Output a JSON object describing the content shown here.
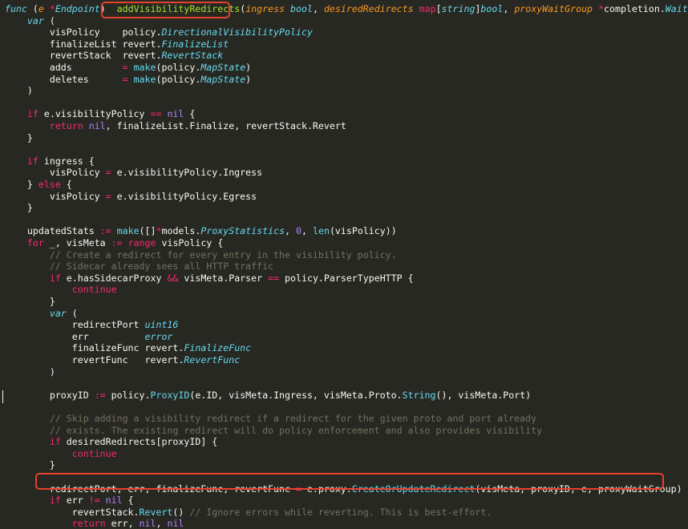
{
  "colors": {
    "background": "#272822",
    "plain": "#f8f8f2",
    "keyword": "#f92672",
    "type": "#66d9ef",
    "function": "#a6e22e",
    "parameter": "#fd971f",
    "number": "#ae81ff",
    "comment": "#75715e",
    "highlight_box": "#e8412e"
  },
  "code_lines": [
    [
      [
        "kwi",
        "func"
      ],
      [
        "plain",
        " ("
      ],
      [
        "param",
        "e"
      ],
      [
        "plain",
        " "
      ],
      [
        "op",
        "*"
      ],
      [
        "type",
        "Endpoint"
      ],
      [
        "plain",
        ")  "
      ],
      [
        "fn",
        "addVisibilityRedirects"
      ],
      [
        "plain",
        "("
      ],
      [
        "param",
        "ingress"
      ],
      [
        "plain",
        " "
      ],
      [
        "type",
        "bool"
      ],
      [
        "plain",
        ", "
      ],
      [
        "param",
        "desiredRedirects"
      ],
      [
        "plain",
        " "
      ],
      [
        "kw",
        "map"
      ],
      [
        "plain",
        "["
      ],
      [
        "type",
        "string"
      ],
      [
        "plain",
        "]"
      ],
      [
        "type",
        "bool"
      ],
      [
        "plain",
        ", "
      ],
      [
        "param",
        "proxyWaitGroup"
      ],
      [
        "plain",
        " "
      ],
      [
        "op",
        "*"
      ],
      [
        "plain",
        "completion."
      ],
      [
        "type",
        "WaitGroup"
      ],
      [
        "plain",
        ")"
      ]
    ],
    [
      [
        "plain",
        "    "
      ],
      [
        "kwi",
        "var"
      ],
      [
        "plain",
        " ("
      ]
    ],
    [
      [
        "plain",
        "        visPolicy    policy."
      ],
      [
        "type",
        "DirectionalVisibilityPolicy"
      ]
    ],
    [
      [
        "plain",
        "        finalizeList revert."
      ],
      [
        "type",
        "FinalizeList"
      ]
    ],
    [
      [
        "plain",
        "        revertStack  revert."
      ],
      [
        "type",
        "RevertStack"
      ]
    ],
    [
      [
        "plain",
        "        adds         "
      ],
      [
        "op",
        "="
      ],
      [
        "plain",
        " "
      ],
      [
        "bi",
        "make"
      ],
      [
        "plain",
        "(policy."
      ],
      [
        "type",
        "MapState"
      ],
      [
        "plain",
        ")"
      ]
    ],
    [
      [
        "plain",
        "        deletes      "
      ],
      [
        "op",
        "="
      ],
      [
        "plain",
        " "
      ],
      [
        "bi",
        "make"
      ],
      [
        "plain",
        "(policy."
      ],
      [
        "type",
        "MapState"
      ],
      [
        "plain",
        ")"
      ]
    ],
    [
      [
        "plain",
        "    )"
      ]
    ],
    [],
    [
      [
        "plain",
        "    "
      ],
      [
        "kw",
        "if"
      ],
      [
        "plain",
        " e.visibilityPolicy "
      ],
      [
        "op",
        "=="
      ],
      [
        "plain",
        " "
      ],
      [
        "num",
        "nil"
      ],
      [
        "plain",
        " {"
      ]
    ],
    [
      [
        "plain",
        "        "
      ],
      [
        "kw",
        "return"
      ],
      [
        "plain",
        " "
      ],
      [
        "num",
        "nil"
      ],
      [
        "plain",
        ", finalizeList.Finalize, revertStack.Revert"
      ]
    ],
    [
      [
        "plain",
        "    }"
      ]
    ],
    [],
    [
      [
        "plain",
        "    "
      ],
      [
        "kw",
        "if"
      ],
      [
        "plain",
        " ingress {"
      ]
    ],
    [
      [
        "plain",
        "        visPolicy "
      ],
      [
        "op",
        "="
      ],
      [
        "plain",
        " e.visibilityPolicy.Ingress"
      ]
    ],
    [
      [
        "plain",
        "    } "
      ],
      [
        "kw",
        "else"
      ],
      [
        "plain",
        " {"
      ]
    ],
    [
      [
        "plain",
        "        visPolicy "
      ],
      [
        "op",
        "="
      ],
      [
        "plain",
        " e.visibilityPolicy.Egress"
      ]
    ],
    [
      [
        "plain",
        "    }"
      ]
    ],
    [],
    [
      [
        "plain",
        "    updatedStats "
      ],
      [
        "op",
        ":="
      ],
      [
        "plain",
        " "
      ],
      [
        "bi",
        "make"
      ],
      [
        "plain",
        "([]"
      ],
      [
        "op",
        "*"
      ],
      [
        "plain",
        "models."
      ],
      [
        "type",
        "ProxyStatistics"
      ],
      [
        "plain",
        ", "
      ],
      [
        "num",
        "0"
      ],
      [
        "plain",
        ", "
      ],
      [
        "bi",
        "len"
      ],
      [
        "plain",
        "(visPolicy))"
      ]
    ],
    [
      [
        "plain",
        "    "
      ],
      [
        "kw",
        "for"
      ],
      [
        "plain",
        " _, visMeta "
      ],
      [
        "op",
        ":="
      ],
      [
        "plain",
        " "
      ],
      [
        "kw",
        "range"
      ],
      [
        "plain",
        " visPolicy {"
      ]
    ],
    [
      [
        "cm",
        "        // Create a redirect for every entry in the visibility policy."
      ]
    ],
    [
      [
        "cm",
        "        // Sidecar already sees all HTTP traffic"
      ]
    ],
    [
      [
        "plain",
        "        "
      ],
      [
        "kw",
        "if"
      ],
      [
        "plain",
        " e.hasSidecarProxy "
      ],
      [
        "op",
        "&&"
      ],
      [
        "plain",
        " visMeta.Parser "
      ],
      [
        "op",
        "=="
      ],
      [
        "plain",
        " policy.ParserTypeHTTP {"
      ]
    ],
    [
      [
        "plain",
        "            "
      ],
      [
        "kw",
        "continue"
      ]
    ],
    [
      [
        "plain",
        "        }"
      ]
    ],
    [
      [
        "plain",
        "        "
      ],
      [
        "kwi",
        "var"
      ],
      [
        "plain",
        " ("
      ]
    ],
    [
      [
        "plain",
        "            redirectPort "
      ],
      [
        "type",
        "uint16"
      ]
    ],
    [
      [
        "plain",
        "            err          "
      ],
      [
        "type",
        "error"
      ]
    ],
    [
      [
        "plain",
        "            finalizeFunc revert."
      ],
      [
        "type",
        "FinalizeFunc"
      ]
    ],
    [
      [
        "plain",
        "            revertFunc   revert."
      ],
      [
        "type",
        "RevertFunc"
      ]
    ],
    [
      [
        "plain",
        "        )"
      ]
    ],
    [],
    [
      [
        "plain",
        "        proxyID "
      ],
      [
        "op",
        ":="
      ],
      [
        "plain",
        " policy."
      ],
      [
        "bi",
        "ProxyID"
      ],
      [
        "plain",
        "(e.ID, visMeta.Ingress, visMeta.Proto."
      ],
      [
        "bi",
        "String"
      ],
      [
        "plain",
        "(), visMeta.Port)"
      ]
    ],
    [],
    [
      [
        "cm",
        "        // Skip adding a visibility redirect if a redirect for the given proto and port already"
      ]
    ],
    [
      [
        "cm",
        "        // exists. The existing redirect will do policy enforcement and also provides visibility"
      ]
    ],
    [
      [
        "plain",
        "        "
      ],
      [
        "kw",
        "if"
      ],
      [
        "plain",
        " desiredRedirects[proxyID] {"
      ]
    ],
    [
      [
        "plain",
        "            "
      ],
      [
        "kw",
        "continue"
      ]
    ],
    [
      [
        "plain",
        "        }"
      ]
    ],
    [],
    [
      [
        "plain",
        "        redirectPort, err, finalizeFunc, revertFunc "
      ],
      [
        "op",
        "="
      ],
      [
        "plain",
        " e.proxy."
      ],
      [
        "bi",
        "CreateOrUpdateRedirect"
      ],
      [
        "plain",
        "(visMeta, proxyID, e, proxyWaitGroup)"
      ]
    ],
    [
      [
        "plain",
        "        "
      ],
      [
        "kw",
        "if"
      ],
      [
        "plain",
        " err "
      ],
      [
        "op",
        "!="
      ],
      [
        "plain",
        " "
      ],
      [
        "num",
        "nil"
      ],
      [
        "plain",
        " {"
      ]
    ],
    [
      [
        "plain",
        "            revertStack."
      ],
      [
        "bi",
        "Revert"
      ],
      [
        "plain",
        "() "
      ],
      [
        "cm",
        "// Ignore errors while reverting. This is best-effort."
      ]
    ],
    [
      [
        "plain",
        "            "
      ],
      [
        "kw",
        "return"
      ],
      [
        "plain",
        " err, "
      ],
      [
        "num",
        "nil"
      ],
      [
        "plain",
        ", "
      ],
      [
        "num",
        "nil"
      ]
    ],
    [
      [
        "plain",
        "        }"
      ]
    ]
  ]
}
